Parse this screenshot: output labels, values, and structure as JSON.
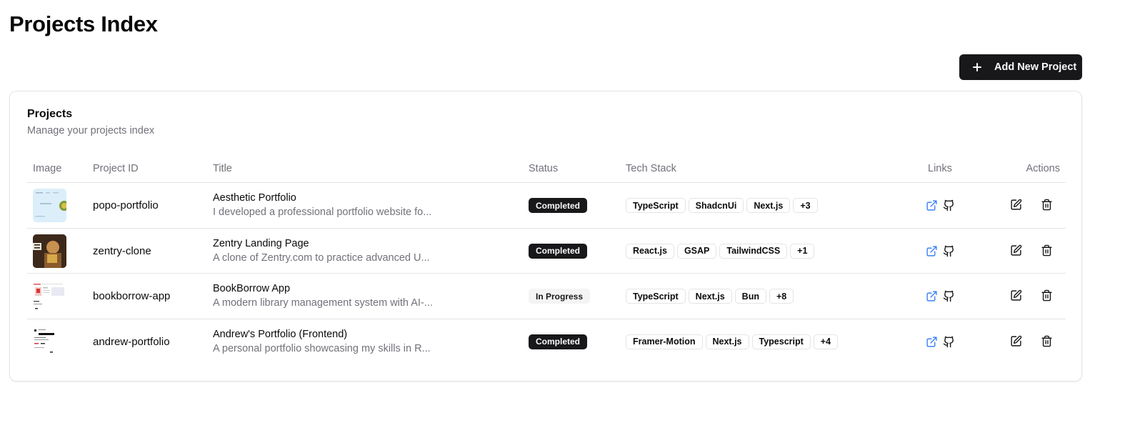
{
  "page": {
    "title": "Projects Index",
    "add_button_label": "Add New Project"
  },
  "card": {
    "title": "Projects",
    "description": "Manage your projects index"
  },
  "columns": {
    "image": "Image",
    "project_id": "Project ID",
    "title": "Title",
    "status": "Status",
    "tech_stack": "Tech Stack",
    "links": "Links",
    "actions": "Actions"
  },
  "colors": {
    "primary": "#18181b",
    "muted_text": "#71717a",
    "border": "#e4e4e7",
    "link_icon": "#3b82f6"
  },
  "rows": [
    {
      "id": "popo-portfolio",
      "title": "Aesthetic Portfolio",
      "description": "I developed a professional portfolio website fo...",
      "status": "Completed",
      "tags": [
        {
          "label": "TypeScript"
        },
        {
          "label": "ShadcnUi"
        },
        {
          "label": "Next.js"
        },
        {
          "label": "+3"
        }
      ]
    },
    {
      "id": "zentry-clone",
      "title": "Zentry Landing Page",
      "description": "A clone of Zentry.com to practice advanced U...",
      "status": "Completed",
      "tags": [
        {
          "label": "React.js"
        },
        {
          "label": "GSAP"
        },
        {
          "label": "TailwindCSS"
        },
        {
          "label": "+1"
        }
      ]
    },
    {
      "id": "bookborrow-app",
      "title": "BookBorrow App",
      "description": "A modern library management system with AI-...",
      "status": "In Progress",
      "tags": [
        {
          "label": "TypeScript"
        },
        {
          "label": "Next.js"
        },
        {
          "label": "Bun"
        },
        {
          "label": "+8"
        }
      ]
    },
    {
      "id": "andrew-portfolio",
      "title": "Andrew's Portfolio (Frontend)",
      "description": "A personal portfolio showcasing my skills in R...",
      "status": "Completed",
      "tags": [
        {
          "label": "Framer-Motion"
        },
        {
          "label": "Next.js"
        },
        {
          "label": "Typescript"
        },
        {
          "label": "+4"
        }
      ]
    }
  ],
  "icons": {
    "add": "plus-icon",
    "live_link": "external-link-icon",
    "repo_link": "github-icon",
    "edit": "edit-icon",
    "delete": "trash-icon"
  }
}
